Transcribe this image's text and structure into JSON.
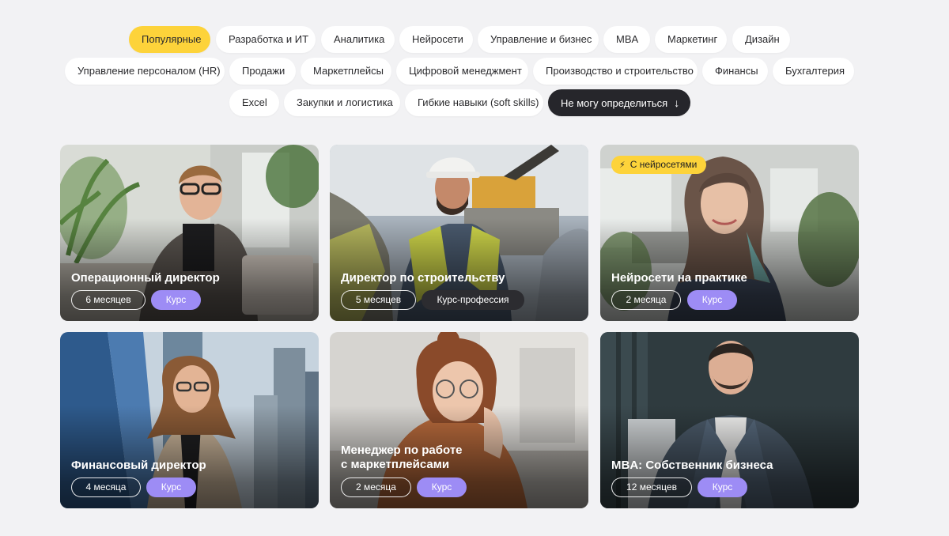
{
  "categories": [
    {
      "label": "Популярные"
    },
    {
      "label": "Разработка и ИТ"
    },
    {
      "label": "Аналитика"
    },
    {
      "label": "Нейросети"
    },
    {
      "label": "Управление и бизнес"
    },
    {
      "label": "MBA"
    },
    {
      "label": "Маркетинг"
    },
    {
      "label": "Дизайн"
    },
    {
      "label": "Управление персоналом (HR)"
    },
    {
      "label": "Продажи"
    },
    {
      "label": "Маркетплейсы"
    },
    {
      "label": "Цифровой менеджмент"
    },
    {
      "label": "Производство и строительство"
    },
    {
      "label": "Финансы"
    },
    {
      "label": "Бухгалтерия"
    },
    {
      "label": "Excel"
    },
    {
      "label": "Закупки и логистика"
    },
    {
      "label": "Гибкие навыки (soft skills)"
    }
  ],
  "active_category": "Популярные",
  "undecided_button": {
    "label": "Не могу определиться",
    "icon": "arrow-down-icon"
  },
  "cards": [
    {
      "title_lines": [
        "Операционный директор"
      ],
      "duration": "6 месяцев",
      "type": "Курс",
      "badge": ""
    },
    {
      "title_lines": [
        "Директор по строительству"
      ],
      "duration": "5 месяцев",
      "type": "Курс-профессия",
      "badge": ""
    },
    {
      "title_lines": [
        "Нейросети на практике"
      ],
      "duration": "2 месяца",
      "type": "Курс",
      "badge": "С нейросетями"
    },
    {
      "title_lines": [
        "Финансовый директор"
      ],
      "duration": "4 месяца",
      "type": "Курс",
      "badge": ""
    },
    {
      "title_lines": [
        "Менеджер по работе",
        "с маркетплейсами"
      ],
      "duration": "2 месяца",
      "type": "Курс",
      "badge": ""
    },
    {
      "title_lines": [
        "MBA: Собственник бизнеса"
      ],
      "duration": "12 месяцев",
      "type": "Курс",
      "badge": ""
    }
  ],
  "colors": {
    "page_bg": "#f2f2f4",
    "chip_bg": "#ffffff",
    "chip_active": "#fdd33a",
    "chip_dark": "#26262b",
    "course_pill": "#9d8cf5",
    "profession_pill": "#2c2c30",
    "ai_badge": "#fdd33a"
  }
}
